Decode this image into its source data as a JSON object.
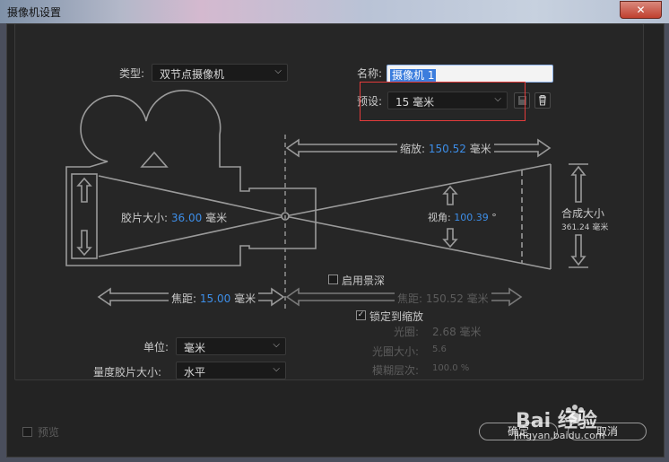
{
  "window": {
    "title": "摄像机设置",
    "close": "✕"
  },
  "type_field": {
    "label": "类型:",
    "value": "双节点摄像机"
  },
  "name_field": {
    "label": "名称:",
    "value": "摄像机 1"
  },
  "preset_field": {
    "label": "预设:",
    "value": "15 毫米"
  },
  "diagram": {
    "zoom_label": "缩放:",
    "zoom_value": "150.52",
    "zoom_unit": "毫米",
    "film_label": "胶片大小:",
    "film_value": "36.00",
    "film_unit": "毫米",
    "angle_label": "视角:",
    "angle_value": "100.39",
    "angle_unit": "°",
    "comp_label": "合成大小",
    "comp_value": "361.24 毫米",
    "focal_label": "焦距:",
    "focal_value": "15.00",
    "focal_unit": "毫米",
    "focus_label": "焦距:",
    "focus_value": "150.52 毫米"
  },
  "dof": {
    "label": "启用景深",
    "checked": false
  },
  "lock": {
    "label": "锁定到缩放",
    "checked": true
  },
  "aperture": {
    "label": "光圈:",
    "value": "2.68 毫米"
  },
  "fstop": {
    "label": "光圈大小:",
    "value": "5.6"
  },
  "blur": {
    "label": "模糊层次:",
    "value": "100.0 %"
  },
  "units": {
    "label": "单位:",
    "value": "毫米"
  },
  "measure_film": {
    "label": "量度胶片大小:",
    "value": "水平"
  },
  "preview": {
    "label": "预览",
    "checked": false
  },
  "buttons": {
    "ok": "确定",
    "cancel": "取消"
  },
  "watermark": {
    "brand": "Bai 经验",
    "url": "jingyan.baidu.com"
  },
  "colors": {
    "accent": "#3d8ee8",
    "highlight": "#e23b3b"
  }
}
